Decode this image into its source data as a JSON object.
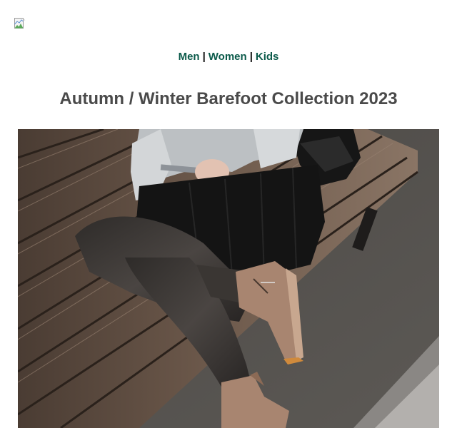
{
  "logo": {
    "icon": "broken-image-icon"
  },
  "nav": {
    "links": [
      "Men",
      "Women",
      "Kids"
    ],
    "separator": "|"
  },
  "headline": "Autumn / Winter Barefoot Collection 2023",
  "colors": {
    "nav_link": "#0b5a4a",
    "headline": "#4a4a4a",
    "background": "#ffffff"
  },
  "hero": {
    "icon": "product-photo-woman-sitting-on-bench-in-barefoot-boots"
  }
}
